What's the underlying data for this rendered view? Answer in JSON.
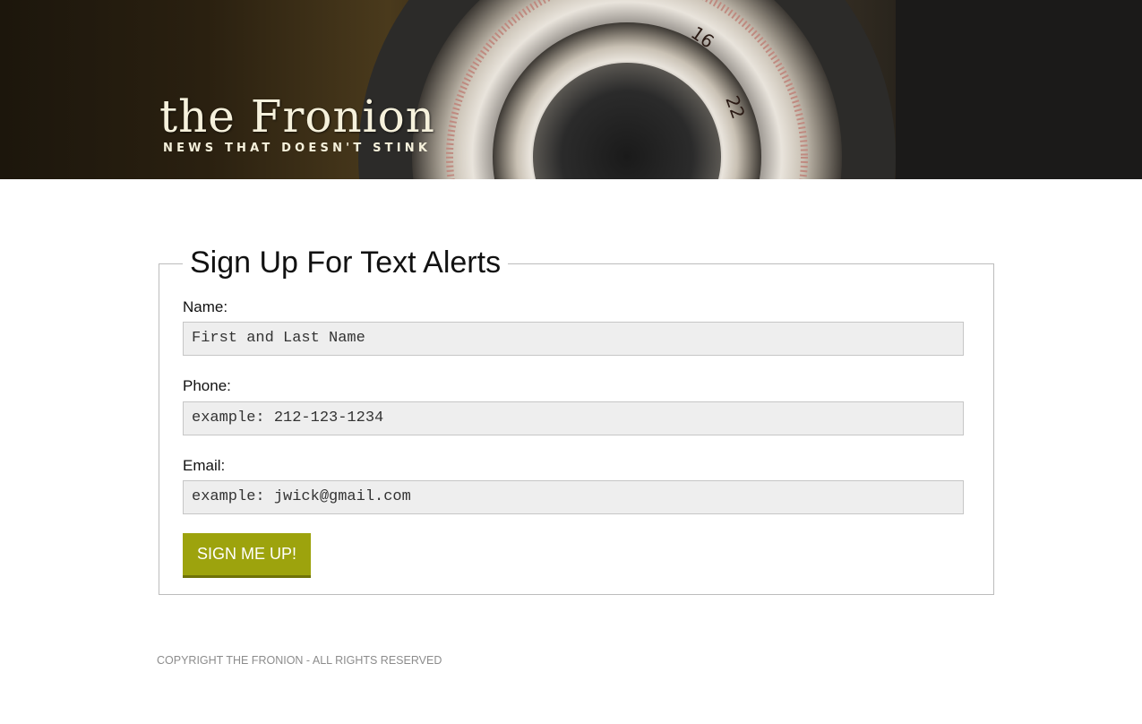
{
  "header": {
    "logo_title": "the Fronion",
    "tagline": "NEWS THAT DOESN'T STINK"
  },
  "form": {
    "legend": "Sign Up For Text Alerts",
    "name": {
      "label": "Name:",
      "placeholder": "First and Last Name"
    },
    "phone": {
      "label": "Phone:",
      "placeholder": "example: 212-123-1234"
    },
    "email": {
      "label": "Email:",
      "placeholder": "example: jwick@gmail.com"
    },
    "submit_label": "SIGN ME UP!"
  },
  "footer": {
    "copyright": "COPYRIGHT THE FRONION - ALL RIGHTS RESERVED"
  },
  "colors": {
    "accent": "#9da30d",
    "input_bg": "#eeeeee",
    "footer_text": "#8c8c8c"
  },
  "icons": {
    "banner_image": "camera-lens-photo"
  }
}
